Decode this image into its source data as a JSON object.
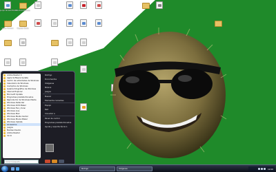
{
  "colors": {
    "desktop_green": "#1f8a2a",
    "taskbar": "#0b0f19",
    "menu_bg": "#1d1d25",
    "accent_red": "#c8202a",
    "selection_blue": "#3a79c8"
  },
  "desktop": {
    "icons": [
      {
        "label": "Equipo de escritorio",
        "kind": "file",
        "tint": "#5a93d0"
      },
      {
        "label": "Mis documentos",
        "kind": "folder",
        "tint": ""
      },
      {
        "label": "",
        "kind": "file",
        "tint": "#d0d0d0"
      },
      {
        "label": "",
        "kind": "file",
        "tint": "#5a8ad0"
      },
      {
        "label": "",
        "kind": "file",
        "tint": "#c8202a"
      },
      {
        "label": "",
        "kind": "file",
        "tint": "#d04a4a"
      },
      {
        "label": "",
        "kind": "folder",
        "tint": ""
      },
      {
        "label": "",
        "kind": "file",
        "tint": "#808080"
      },
      {
        "label": "",
        "kind": "folder",
        "tint": ""
      },
      {
        "label": "Valve Fichero",
        "kind": "folder",
        "tint": ""
      },
      {
        "label": "Crystal Sleds",
        "kind": "folder",
        "tint": ""
      },
      {
        "label": "",
        "kind": "file",
        "tint": "#d04a4a"
      },
      {
        "label": "",
        "kind": "file",
        "tint": "#d0d0d0"
      },
      {
        "label": "",
        "kind": "file",
        "tint": "#5a8ad0"
      },
      {
        "label": "",
        "kind": "file",
        "tint": "#5a8ad0"
      },
      {
        "label": "",
        "kind": "file",
        "tint": "#5a8ad0"
      },
      {
        "label": "",
        "kind": "folder",
        "tint": ""
      },
      {
        "label": "",
        "kind": "file",
        "tint": "#c0c0c0"
      },
      {
        "label": "",
        "kind": "folder",
        "tint": ""
      },
      {
        "label": "",
        "kind": "file",
        "tint": "#d0d0d0"
      },
      {
        "label": "",
        "kind": "file",
        "tint": "#d0d0d0"
      },
      {
        "label": "",
        "kind": "file",
        "tint": "#d0d0d0"
      },
      {
        "label": "",
        "kind": "file",
        "tint": "#d0d0d0"
      },
      {
        "label": "",
        "kind": "file",
        "tint": "#d0d0d0"
      },
      {
        "label": "",
        "kind": "file",
        "tint": "#d0d0d0"
      },
      {
        "label": "",
        "kind": "file",
        "tint": "#d0d0d0"
      },
      {
        "label": "",
        "kind": "file",
        "tint": "#d0d0d0"
      },
      {
        "label": "",
        "kind": "file",
        "tint": "#d0d0d0"
      },
      {
        "label": "",
        "kind": "file",
        "tint": "#d0d0d0"
      },
      {
        "label": "",
        "kind": "file",
        "tint": "#e8a020"
      },
      {
        "label": "",
        "kind": "file",
        "tint": "#d0d0d0"
      },
      {
        "label": "",
        "kind": "file",
        "tint": "#d0d0d0"
      }
    ]
  },
  "start_menu": {
    "programs": [
      "Adobe Reader 9",
      "Apple Software Update",
      "Centro de actividades de Windows",
      "Calendario de Windows",
      "Contactos de Windows",
      "Galería fotográfica de Windows",
      "Internet Explorer",
      "Microsoft Update",
      "Programas predeterminados",
      "Reproductor de Windows Media",
      "Windows Defender",
      "Windows DVD Maker",
      "Windows Fax y Scan",
      "Windows Live",
      "Windows Mail",
      "Windows Media Center",
      "Windows Movie Maker",
      "Windows Update",
      "Accesorios",
      "Juegos",
      "Mantenimiento",
      "Adobe Reader",
      "Inicio"
    ],
    "highlighted_program": "Accesorios",
    "search_placeholder": "Iniciar búsqueda",
    "places": [
      "Rodrigo",
      "Documentos",
      "Imágenes",
      "Música",
      "Juegos",
      "Buscar",
      "Elementos recientes",
      "Equipo",
      "Red",
      "Conectar a",
      "Panel de control",
      "Programas predeterminados",
      "Ayuda y soporte técnico"
    ]
  },
  "taskbar": {
    "buttons": [
      {
        "label": "Rodrigo"
      },
      {
        "label": "Imágenes"
      }
    ],
    "clock": "12:00"
  }
}
